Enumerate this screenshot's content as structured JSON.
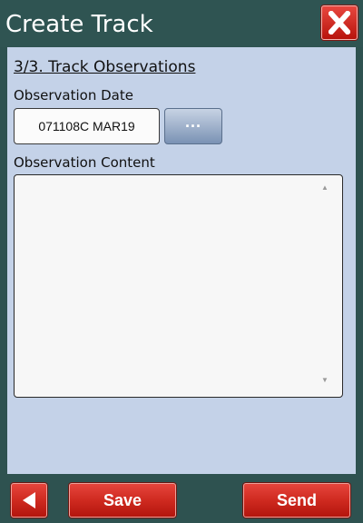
{
  "window": {
    "title": "Create Track",
    "close_icon": "close-x-icon"
  },
  "form": {
    "step_title": "3/3. Track Observations",
    "observation_date_label": "Observation Date",
    "observation_date_value": "071108C MAR19",
    "date_picker_label": "...",
    "observation_content_label": "Observation Content",
    "observation_content_value": ""
  },
  "footer": {
    "back_icon": "triangle-left-icon",
    "save_label": "Save",
    "send_label": "Send"
  },
  "colors": {
    "frame": "#2e5250",
    "panel": "#c4d2e8",
    "button_red": "#cf2a20",
    "date_button": "#7a92b4"
  }
}
